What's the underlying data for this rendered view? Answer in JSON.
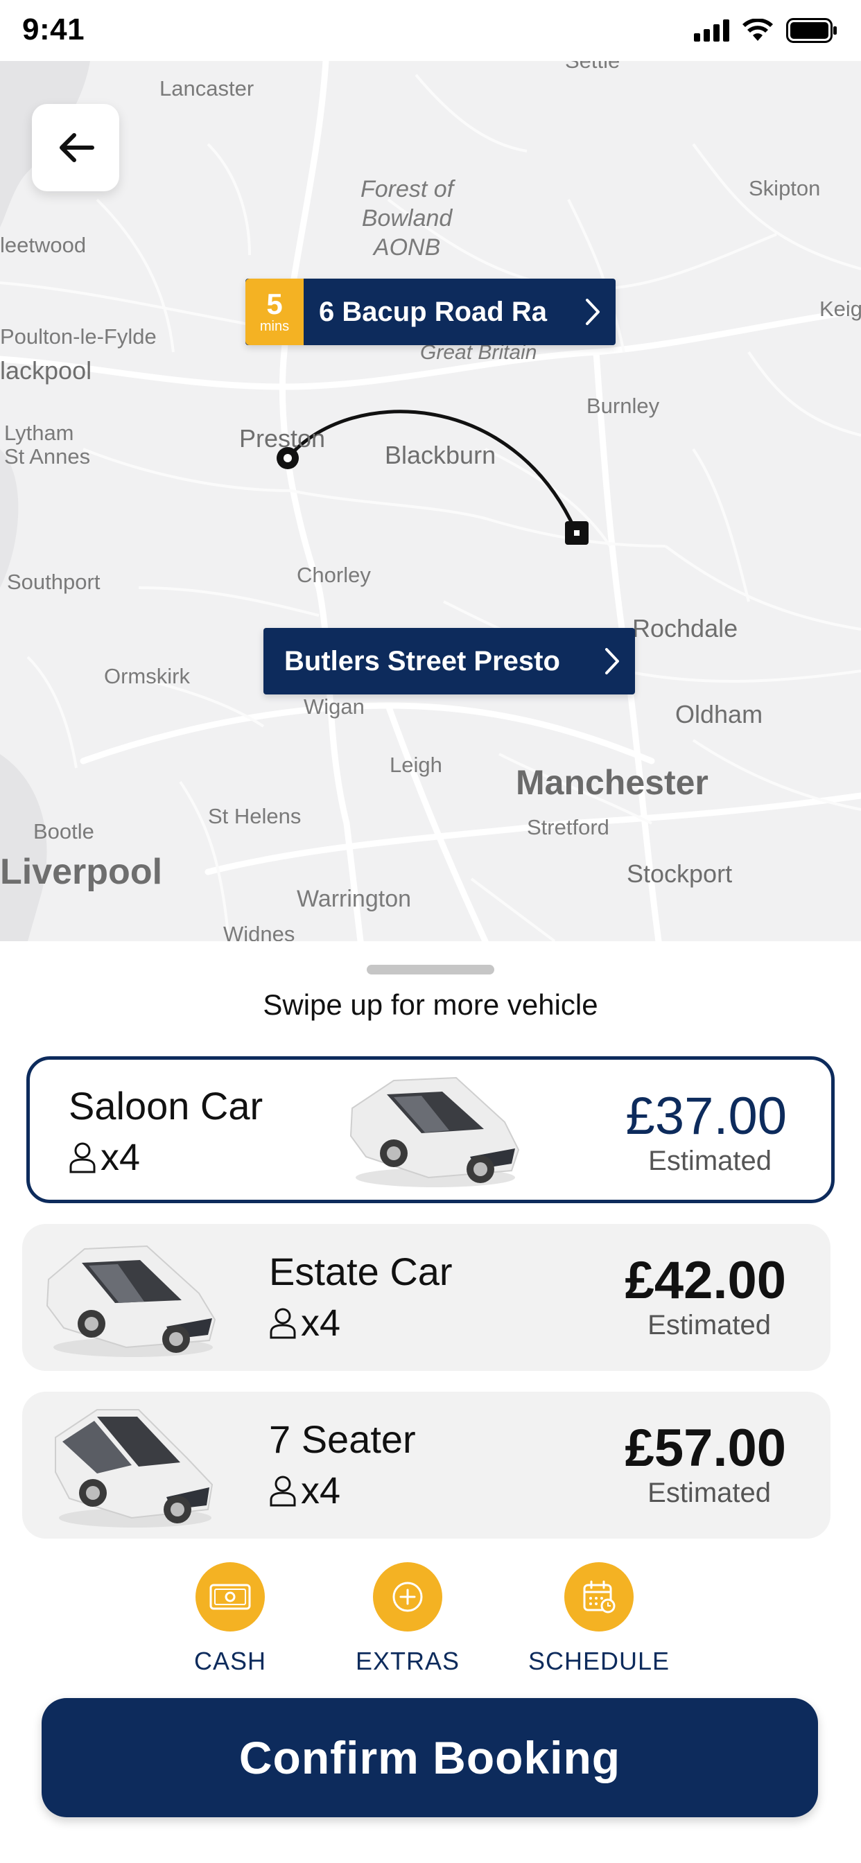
{
  "status_bar": {
    "time": "9:41"
  },
  "map": {
    "places": {
      "top_fragment": "Settle",
      "lancaster": "Lancaster",
      "forest": "Forest of\nBowland\nAONB",
      "skipton": "Skipton",
      "fleetwood": "leetwood",
      "keighley": "Keig",
      "poulton": "Poulton-le-Fylde",
      "blackpool": "lackpool",
      "great_britain": "Great Britain",
      "burnley": "Burnley",
      "lytham": "Lytham\nSt Annes",
      "preston": "Preston",
      "blackburn": "Blackburn",
      "southport": "Southport",
      "chorley": "Chorley",
      "rochdale": "Rochdale",
      "ormskirk": "Ormskirk",
      "wigan": "Wigan",
      "oldham": "Oldham",
      "leigh": "Leigh",
      "manchester": "Manchester",
      "bootle": "Bootle",
      "st_helens": "St Helens",
      "stretford": "Stretford",
      "liverpool": "Liverpool",
      "stockport": "Stockport",
      "warrington": "Warrington",
      "widnes": "Widnes"
    },
    "pickup": {
      "eta_value": "5",
      "eta_unit": "mins",
      "address": "6 Bacup Road Ra"
    },
    "dropoff": {
      "address": "Butlers Street Presto"
    }
  },
  "sheet": {
    "swipe_hint": "Swipe up for more vehicle",
    "vehicles": [
      {
        "name": "Saloon Car",
        "capacity": "x4",
        "price": "£37.00",
        "price_note": "Estimated",
        "selected": true
      },
      {
        "name": "Estate Car",
        "capacity": "x4",
        "price": "£42.00",
        "price_note": "Estimated",
        "selected": false
      },
      {
        "name": "7 Seater",
        "capacity": "x4",
        "price": "£57.00",
        "price_note": "Estimated",
        "selected": false
      }
    ],
    "actions": [
      {
        "label": "CASH",
        "icon": "cash-icon"
      },
      {
        "label": "EXTRAS",
        "icon": "plus-icon"
      },
      {
        "label": "SCHEDULE",
        "icon": "calendar-icon"
      }
    ],
    "confirm_label": "Confirm Booking"
  },
  "colors": {
    "navy": "#0d2b5c",
    "accent": "#f4b223"
  }
}
